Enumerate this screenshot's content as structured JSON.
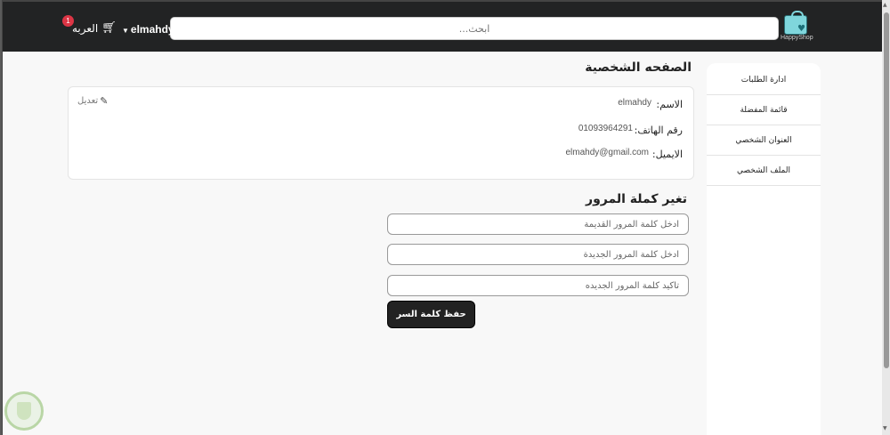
{
  "header": {
    "logo_text": "HappyShop",
    "search_placeholder": "ابحث...",
    "username": "elmahdy",
    "cart_label": "العربه",
    "cart_count": "1"
  },
  "sidebar": {
    "items": [
      {
        "label": "ادارة الطلبات"
      },
      {
        "label": "قائمة المفضلة"
      },
      {
        "label": "العنوان الشخصي"
      },
      {
        "label": "الملف الشخصي"
      }
    ]
  },
  "profile": {
    "title": "الصفحه الشخصية",
    "edit_label": "تعديل",
    "name_label": "الاسم:",
    "name_value": "elmahdy",
    "phone_label": "رقم الهاتف:",
    "phone_value": "01093964291",
    "email_label": "الايميل:",
    "email_value": "elmahdy@gmail.com"
  },
  "password": {
    "title": "تغير كملة المرور",
    "old_placeholder": "ادخل كلمة المرور القديمة",
    "new_placeholder": "ادخل كلمة المرور الجديدة",
    "confirm_placeholder": "تأكيد كلمة المرور الجديده",
    "save_label": "حفظ كلمة السر"
  }
}
